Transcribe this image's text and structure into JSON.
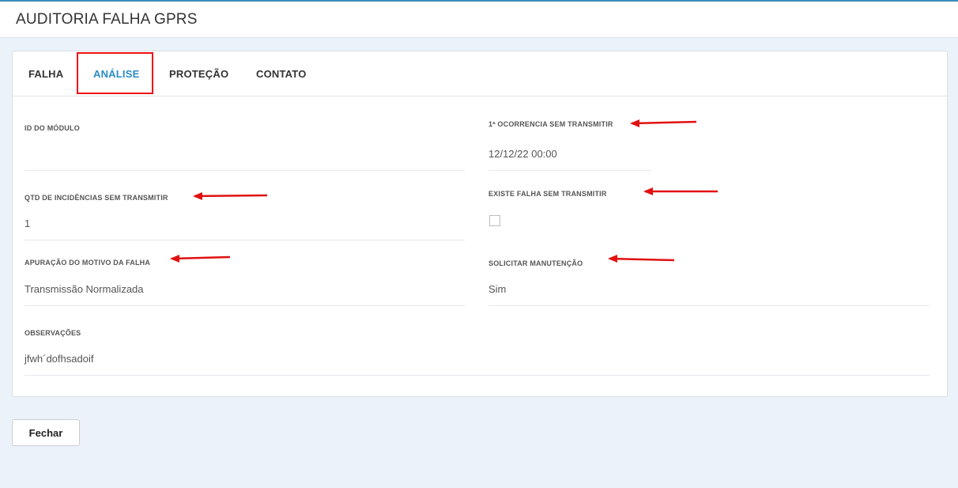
{
  "header": {
    "title": "AUDITORIA FALHA GPRS"
  },
  "tabs": [
    {
      "label": "FALHA"
    },
    {
      "label": "ANÁLISE"
    },
    {
      "label": "PROTEÇÃO"
    },
    {
      "label": "CONTATO"
    }
  ],
  "active_tab": "ANÁLISE",
  "fields": {
    "id_modulo": {
      "label": "ID DO MÓDULO",
      "value": ""
    },
    "primeira_ocorrencia": {
      "label": "1ª OCORRENCIA SEM TRANSMITIR",
      "value": "12/12/22 00:00"
    },
    "qtd_incidencias": {
      "label": "QTD DE INCIDÊNCIAS SEM TRANSMITIR",
      "value": "1"
    },
    "existe_falha": {
      "label": "EXISTE FALHA SEM TRANSMITIR",
      "checked": false
    },
    "apuracao_motivo": {
      "label": "APURAÇÃO DO MOTIVO DA FALHA",
      "value": "Transmissão Normalizada"
    },
    "solicitar_manutencao": {
      "label": "SOLICITAR MANUTENÇÃO",
      "value": "Sim"
    },
    "observacoes": {
      "label": "OBSERVAÇÕES",
      "value": "jfwh´dofhsadoif"
    }
  },
  "footer": {
    "close_label": "Fechar"
  },
  "colors": {
    "active_tab": "#2a8bc4",
    "annotation": "#e11111",
    "page_bg": "#ebf2f9"
  }
}
